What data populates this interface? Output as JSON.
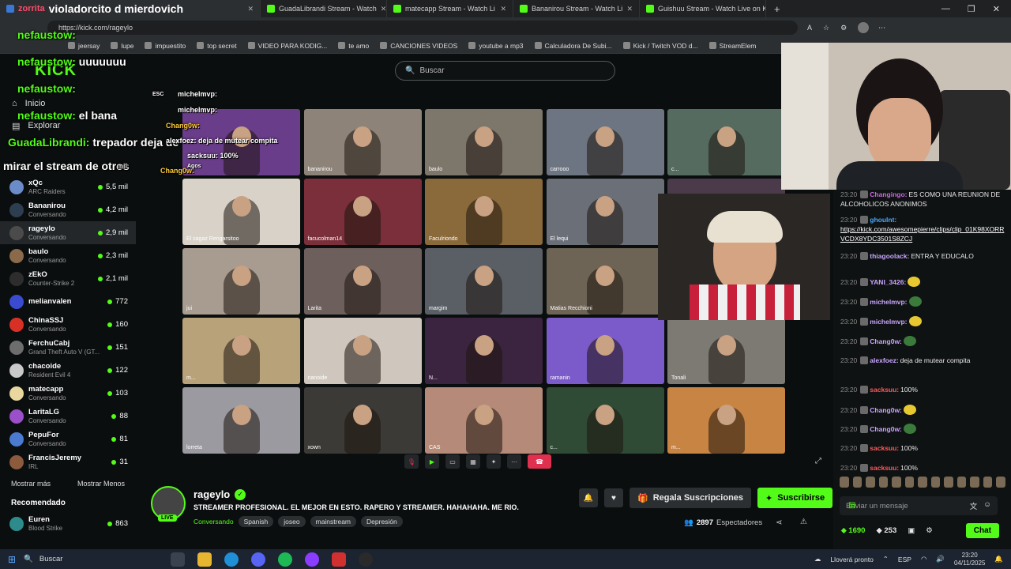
{
  "browser": {
    "tabs": [
      {
        "label": "violadorcito d mierdovich",
        "active": true
      },
      {
        "label": "GuadaLibrandi Stream - Watch"
      },
      {
        "label": "matecapp Stream - Watch Li"
      },
      {
        "label": "Bananirou Stream - Watch Li"
      },
      {
        "label": "Guishuu Stream - Watch Live on Ki"
      }
    ],
    "tab_prefix": "zorrita",
    "new_tab": "+",
    "url": "https://kick.com/rageylo",
    "bookmarks": [
      "jeersay",
      "lupe",
      "impuestito",
      "top secret",
      "VIDEO PARA KODIG...",
      "te amo",
      "CANCIONES VIDEOS",
      "youtube a mp3",
      "Calculadora De Subi...",
      "Kick / Twitch VOD d...",
      "StreamElem"
    ]
  },
  "kick": {
    "logo": "KICK",
    "search_placeholder": "Buscar"
  },
  "nav": [
    {
      "label": "Inicio"
    },
    {
      "label": "Explorar"
    }
  ],
  "channels": [
    {
      "name": "xQc",
      "sub": "ARC Raiders",
      "viewers": "5,5 mil",
      "color": "#6b8cc9"
    },
    {
      "name": "Bananirou",
      "sub": "Conversando",
      "viewers": "4,2 mil",
      "color": "#2c3e50"
    },
    {
      "name": "rageylo",
      "sub": "Conversando",
      "viewers": "2,9 mil",
      "color": "#4b4b4b",
      "selected": true
    },
    {
      "name": "baulo",
      "sub": "Conversando",
      "viewers": "2,3 mil",
      "color": "#8a6a4a"
    },
    {
      "name": "zEkO",
      "sub": "Counter-Strike 2",
      "viewers": "2,1 mil",
      "color": "#2d2d2d"
    },
    {
      "name": "melianvalen",
      "sub": "",
      "viewers": "772",
      "color": "#3a4bcf"
    },
    {
      "name": "ChinaSSJ",
      "sub": "Conversando",
      "viewers": "160",
      "color": "#d93025"
    },
    {
      "name": "FerchuCabj",
      "sub": "Grand Theft Auto V (GT...",
      "viewers": "151",
      "color": "#6d6d6d"
    },
    {
      "name": "chacoide",
      "sub": "Resident Evil 4",
      "viewers": "122",
      "color": "#c9c9c9"
    },
    {
      "name": "matecapp",
      "sub": "Conversando",
      "viewers": "103",
      "color": "#e8d8a0"
    },
    {
      "name": "LaritaLG",
      "sub": "Conversando",
      "viewers": "88",
      "color": "#9b4fc9"
    },
    {
      "name": "PepuFor",
      "sub": "Conversando",
      "viewers": "81",
      "color": "#4a7bd0"
    },
    {
      "name": "FrancisJeremy",
      "sub": "IRL",
      "viewers": "31",
      "color": "#8c5a3c"
    }
  ],
  "sidebar_links": {
    "more": "Mostrar más",
    "less": "Mostrar Menos"
  },
  "recommended": {
    "title": "Recomendado",
    "items": [
      {
        "name": "Euren",
        "sub": "Blood Strike",
        "viewers": "863",
        "color": "#2e8b8b"
      }
    ]
  },
  "tiles": [
    {
      "label": "",
      "bg": "#6a3d8a"
    },
    {
      "label": "bananirou",
      "bg": "#8d8378"
    },
    {
      "label": "baulo",
      "bg": "#7d766a"
    },
    {
      "label": "carrooo",
      "bg": "#6e7582"
    },
    {
      "label": "c...",
      "bg": "#556b5f"
    },
    {
      "label": "El sagaz Rengarsitoo",
      "bg": "#d8d2c8"
    },
    {
      "label": "facucolman14",
      "bg": "#7a2f3a"
    },
    {
      "label": "Faculriondo",
      "bg": "#8a6a3a"
    },
    {
      "label": "El lequi",
      "bg": "#6a6f78"
    },
    {
      "label": "",
      "bg": "#4a3a4a"
    },
    {
      "label": "jui",
      "bg": "#a89b90"
    },
    {
      "label": "Larita",
      "bg": "#6d5f5c"
    },
    {
      "label": "margim",
      "bg": "#5a5f66"
    },
    {
      "label": "Matias Recchioni",
      "bg": "#6e6455"
    },
    {
      "label": "",
      "bg": "#3b3632"
    },
    {
      "label": "m...",
      "bg": "#b8a27a"
    },
    {
      "label": "nanoide",
      "bg": "#cfc7bd"
    },
    {
      "label": "N...",
      "bg": "#3a2440"
    },
    {
      "label": "ramanin",
      "bg": "#7b5ac9"
    },
    {
      "label": "Tonali",
      "bg": "#7d7a74"
    },
    {
      "label": "lorreta",
      "bg": "#9a9aa0"
    },
    {
      "label": "xown",
      "bg": "#3c3a36"
    },
    {
      "label": "CAS",
      "bg": "#b68a78"
    },
    {
      "label": "c...",
      "bg": "#2f4a35"
    },
    {
      "label": "m...",
      "bg": "#c88442"
    }
  ],
  "overlay_chat": [
    {
      "user": "nefaustow:",
      "text": ""
    },
    {
      "user": "nefaustow:",
      "text": "uuuuuuu"
    },
    {
      "user": "nefaustow:",
      "text": ""
    },
    {
      "user": "nefaustow:",
      "text": "el bana"
    },
    {
      "user": "GuadaLibrandi:",
      "text": "trepador deja de"
    },
    {
      "user": "",
      "text": "mirar el stream de otros"
    }
  ],
  "mini_overlay": [
    {
      "user": "michelmvp:",
      "text": ""
    },
    {
      "user": "michelmvp:",
      "text": ""
    },
    {
      "user": "Chang0w:",
      "text": ""
    },
    {
      "user": "alexfoez:",
      "text": "deja de mutear compita"
    },
    {
      "user": "sacksuu:",
      "text": "100%"
    },
    {
      "user": "Chang0w:",
      "text": ""
    }
  ],
  "overlay_misc": {
    "esc": "ESC",
    "agos": "Agos",
    "mil": "mil"
  },
  "channel": {
    "name": "rageylo",
    "live": "LIVE",
    "title": "STREAMER PROFESIONAL. EL MEJOR EN ESTO. RAPERO Y STREAMER. HAHAHAHA. ME RIO.",
    "category": "Conversando",
    "tags": [
      "Spanish",
      "joseo",
      "mainstream",
      "Depresión"
    ],
    "gift_label": "Regala Suscripciones",
    "subscribe_label": "Suscribirse",
    "viewers": "2897",
    "viewers_label": "Espectadores"
  },
  "chat": {
    "messages": [
      {
        "time": "23:20",
        "user": "Changingo:",
        "color": "#c96be0",
        "text": "ES COMO UNA REUNION DE ALCOHOLICOS ANONIMOS"
      },
      {
        "time": "23:20",
        "user": "ghoulnt:",
        "color": "#4aa8ff",
        "text": "",
        "link": "https://kick.com/awesomepierre/clips/clip_01K98XORRVCDX8YDC3501S8ZCJ"
      },
      {
        "time": "23:20",
        "user": "thiagoolack:",
        "color": "#c9a6ff",
        "text": "ENTRA Y EDUCALO"
      },
      {
        "time": "23:20",
        "user": "YANI_3426:",
        "color": "#c9a6ff",
        "text": ""
      },
      {
        "time": "23:20",
        "user": "michelmvp:",
        "color": "#c9a6ff",
        "text": ""
      },
      {
        "time": "23:20",
        "user": "michelmvp:",
        "color": "#c9a6ff",
        "text": ""
      },
      {
        "time": "23:20",
        "user": "Chang0w:",
        "color": "#c9a6ff",
        "text": ""
      },
      {
        "time": "23:20",
        "user": "alexfoez:",
        "color": "#c9a6ff",
        "text": "deja de mutear compita"
      },
      {
        "time": "23:20",
        "user": "sacksuu:",
        "color": "#ff5a5a",
        "text": "100%"
      },
      {
        "time": "23:20",
        "user": "Chang0w:",
        "color": "#c9a6ff",
        "text": ""
      },
      {
        "time": "23:20",
        "user": "Chang0w:",
        "color": "#c9a6ff",
        "text": ""
      },
      {
        "time": "23:20",
        "user": "sacksuu:",
        "color": "#ff5a5a",
        "text": "100%"
      },
      {
        "time": "23:20",
        "user": "sacksuu:",
        "color": "#ff5a5a",
        "text": "100%"
      }
    ],
    "input_placeholder": "Enviar un mensaje",
    "points": "1690",
    "kicks": "253",
    "chat_button": "Chat"
  },
  "taskbar": {
    "search": "Buscar",
    "weather": "Lloverá pronto",
    "lang": "ESP",
    "time": "23:20",
    "date": "04/11/2025"
  },
  "colors": {
    "accent": "#53fc18",
    "live_red": "#e0304f"
  }
}
